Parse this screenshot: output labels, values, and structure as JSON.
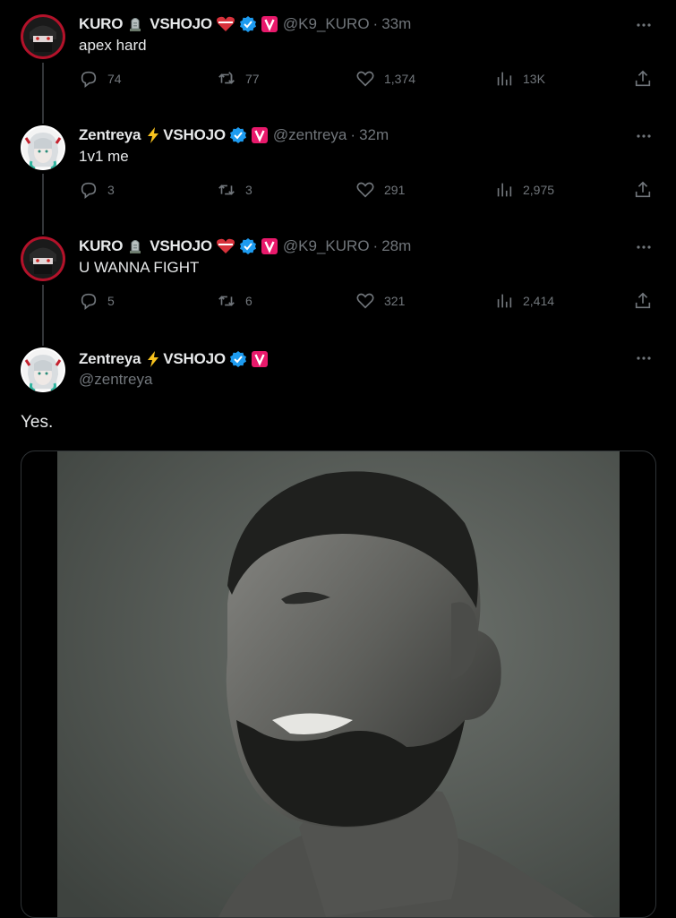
{
  "tweets": [
    {
      "name": "KURO",
      "brand": "VSHOJO",
      "handle": "@K9_KURO",
      "time": "33m",
      "text": "apex hard",
      "stats": {
        "replies": "74",
        "reposts": "77",
        "likes": "1,374",
        "views": "13K"
      }
    },
    {
      "name": "Zentreya",
      "brand": "VSHOJO",
      "handle": "@zentreya",
      "time": "32m",
      "text": "1v1 me",
      "stats": {
        "replies": "3",
        "reposts": "3",
        "likes": "291",
        "views": "2,975"
      }
    },
    {
      "name": "KURO",
      "brand": "VSHOJO",
      "handle": "@K9_KURO",
      "time": "28m",
      "text": "U WANNA FIGHT",
      "stats": {
        "replies": "5",
        "reposts": "6",
        "likes": "321",
        "views": "2,414"
      }
    }
  ],
  "main_tweet": {
    "name": "Zentreya",
    "brand": "VSHOJO",
    "handle": "@zentreya",
    "text": "Yes."
  },
  "separator": "·",
  "colors": {
    "background": "#000000",
    "text": "#e7e9ea",
    "muted": "#71767b",
    "verified": "#1d9bf0",
    "vshojo_badge": "#e8196b"
  },
  "icons": [
    "reply-icon",
    "repost-icon",
    "like-icon",
    "views-icon",
    "share-icon",
    "more-icon",
    "verified-icon",
    "lightning-icon",
    "tombstone-icon",
    "heart-emoji-icon"
  ]
}
